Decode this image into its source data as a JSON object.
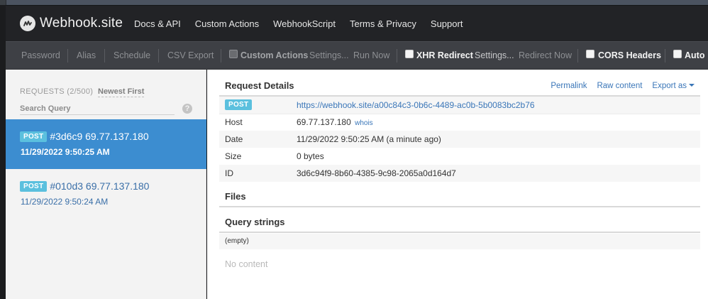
{
  "navbar": {
    "brand": "Webhook.site",
    "links": [
      "Docs & API",
      "Custom Actions",
      "WebhookScript",
      "Terms & Privacy",
      "Support"
    ]
  },
  "toolbar": {
    "password": "Password",
    "alias": "Alias",
    "schedule": "Schedule",
    "csv_export": "CSV Export",
    "custom_actions": "Custom Actions",
    "custom_settings": "Settings...",
    "run_now": "Run Now",
    "xhr_redirect": "XHR Redirect",
    "xhr_settings": "Settings...",
    "redirect_now": "Redirect Now",
    "cors_headers": "CORS Headers",
    "auto": "Auto"
  },
  "sidebar": {
    "requests_label": "REQUESTS (2/500)",
    "sort_label": "Newest First",
    "search_placeholder": "Search Query",
    "help": "?",
    "items": [
      {
        "method": "POST",
        "title": "#3d6c9 69.77.137.180",
        "date": "11/29/2022 9:50:25 AM"
      },
      {
        "method": "POST",
        "title": "#010d3 69.77.137.180",
        "date": "11/29/2022 9:50:24 AM"
      }
    ]
  },
  "details": {
    "title": "Request Details",
    "permalink": "Permalink",
    "raw_content": "Raw content",
    "export_as": "Export as",
    "method": "POST",
    "url": "https://webhook.site/a00c84c3-0b6c-4489-ac0b-5b0083bc2b76",
    "host_label": "Host",
    "host_value": "69.77.137.180",
    "whois": "whois",
    "date_label": "Date",
    "date_value": "11/29/2022 9:50:25 AM (a minute ago)",
    "size_label": "Size",
    "size_value": "0 bytes",
    "id_label": "ID",
    "id_value": "3d6c94f9-8b60-4385-9c98-2065a0d164d7"
  },
  "files": {
    "title": "Files"
  },
  "query_strings": {
    "title": "Query strings",
    "empty": "(empty)"
  },
  "content": {
    "no_content": "No content"
  },
  "icons": {
    "logo": "webhook-logo-icon",
    "caret": "caret-down-icon",
    "help": "question-circle-icon"
  }
}
